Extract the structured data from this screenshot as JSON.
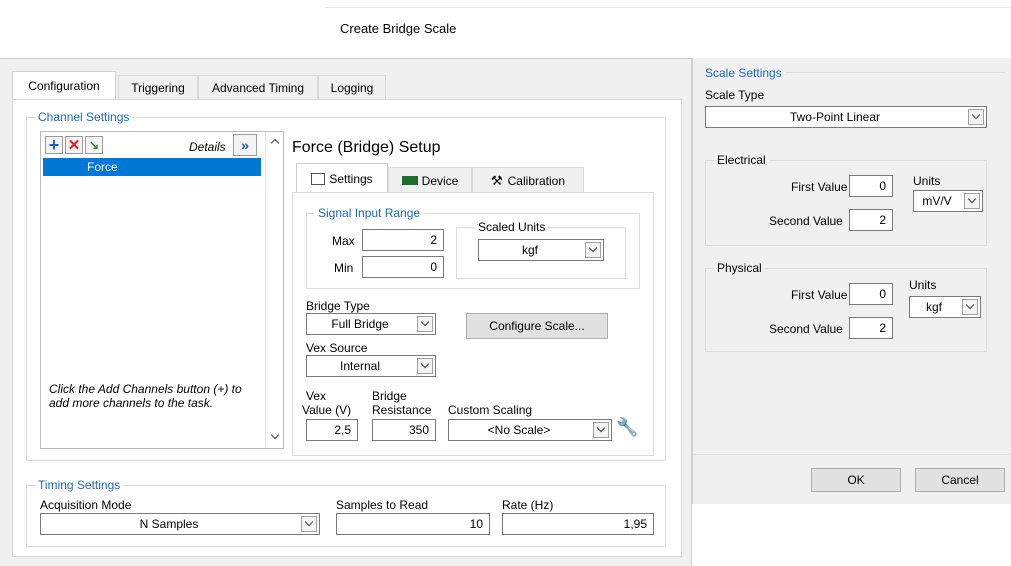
{
  "bridge_dialog": {
    "title": "Create Bridge Scale",
    "scale_settings": {
      "legend": "Scale Settings",
      "scale_type_label": "Scale Type",
      "scale_type_value": "Two-Point Linear"
    },
    "electrical": {
      "legend": "Electrical",
      "first_label": "First Value",
      "first_value": "0",
      "second_label": "Second Value",
      "second_value": "2",
      "units_label": "Units",
      "units_value": "mV/V"
    },
    "physical": {
      "legend": "Physical",
      "first_label": "First Value",
      "first_value": "0",
      "second_label": "Second Value",
      "second_value": "2",
      "units_label": "Units",
      "units_value": "kgf"
    },
    "ok_label": "OK",
    "cancel_label": "Cancel"
  },
  "main_panel": {
    "tabs": [
      "Configuration",
      "Triggering",
      "Advanced Timing",
      "Logging"
    ],
    "channel_settings": {
      "legend": "Channel Settings",
      "details_label": "Details",
      "channels": [
        "Force"
      ],
      "hint": "Click the Add Channels button (+) to add more channels to the task."
    },
    "setup": {
      "title": "Force (Bridge) Setup",
      "tabs": [
        "Settings",
        "Device",
        "Calibration"
      ],
      "signal_input_range": {
        "legend": "Signal Input Range",
        "max_label": "Max",
        "max_value": "2",
        "min_label": "Min",
        "min_value": "0",
        "scaled_units_label": "Scaled Units",
        "scaled_units_value": "kgf"
      },
      "bridge_type_label": "Bridge Type",
      "bridge_type_value": "Full Bridge",
      "configure_scale_label": "Configure Scale...",
      "vex_source_label": "Vex Source",
      "vex_source_value": "Internal",
      "vex_value_label_1": "Vex",
      "vex_value_label_2": "Value (V)",
      "vex_value": "2,5",
      "bridge_resistance_label_1": "Bridge",
      "bridge_resistance_label_2": "Resistance",
      "bridge_resistance_value": "350",
      "custom_scaling_label": "Custom Scaling",
      "custom_scaling_value": "<No Scale>"
    },
    "timing_settings": {
      "legend": "Timing Settings",
      "acquisition_mode_label": "Acquisition Mode",
      "acquisition_mode_value": "N Samples",
      "samples_to_read_label": "Samples to Read",
      "samples_to_read_value": "10",
      "rate_label": "Rate (Hz)",
      "rate_value": "1,95"
    }
  },
  "colors": {
    "accent_blue": "#1e6bbf",
    "selection_blue": "#0078d7",
    "dialog_bg": "#f0f0f0"
  }
}
